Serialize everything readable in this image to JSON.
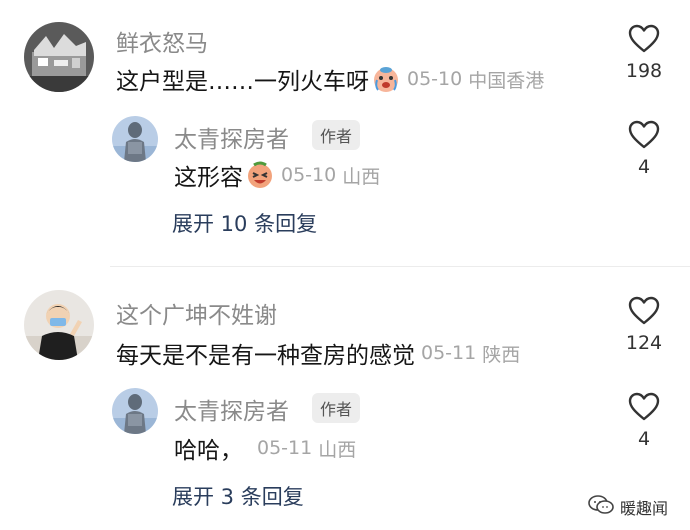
{
  "comments": [
    {
      "username": "鲜衣怒马",
      "text": "这户型是……一列火车呀",
      "emoji_icon": "crying-face-icon",
      "date": "05-10",
      "location": "中国香港",
      "likes": "198",
      "reply": {
        "username": "太青探房者",
        "badge": "作者",
        "text": "这形容",
        "emoji_icon": "laughing-face-icon",
        "date": "05-10",
        "location": "山西",
        "likes": "4"
      },
      "expand_label": "展开 10 条回复"
    },
    {
      "username": "这个广坤不姓谢",
      "text": "每天是不是有一种查房的感觉",
      "date": "05-11",
      "location": "陕西",
      "likes": "124",
      "reply": {
        "username": "太青探房者",
        "badge": "作者",
        "text": "哈哈，",
        "date": "05-11",
        "location": "山西",
        "likes": "4"
      },
      "expand_label": "展开 3 条回复"
    }
  ],
  "watermark": "暖趣闻",
  "colors": {
    "username": "#8a8a8a",
    "meta": "#a5a5a5",
    "expand": "#2a3d5c",
    "badge_bg": "#ededed"
  }
}
